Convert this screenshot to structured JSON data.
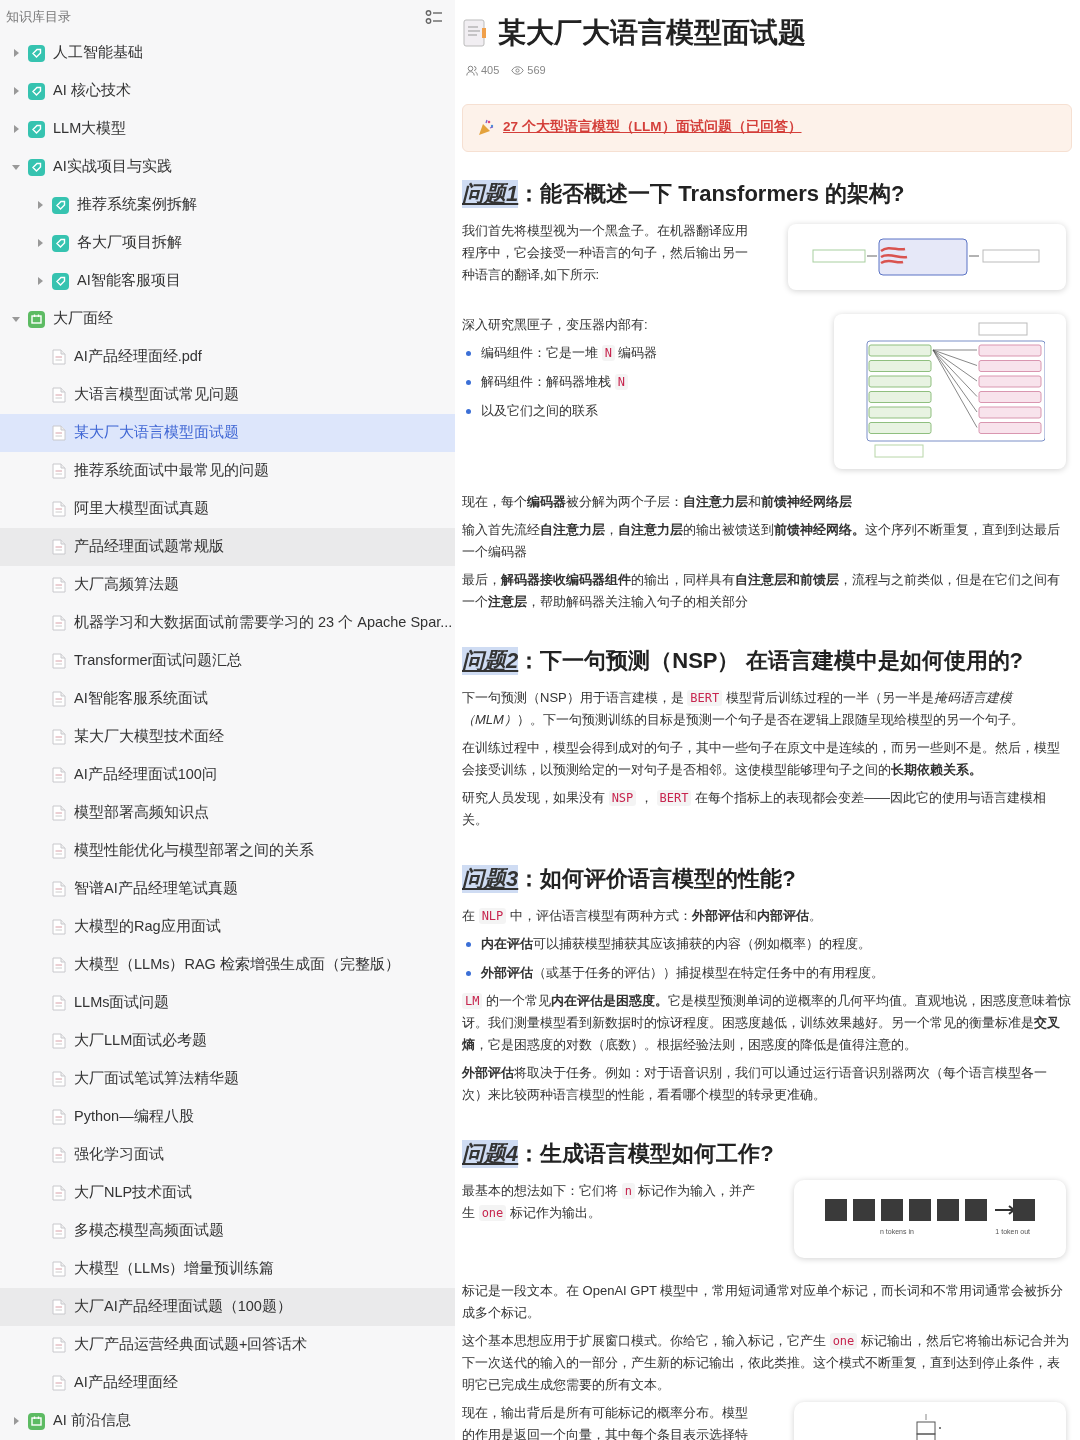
{
  "sidebar": {
    "title": "知识库目录",
    "items": [
      {
        "kind": "folder",
        "label": "人工智能基础",
        "expanded": false,
        "selected": false,
        "highlighted": false
      },
      {
        "kind": "folder",
        "label": "AI 核心技术",
        "expanded": false,
        "selected": false,
        "highlighted": false
      },
      {
        "kind": "folder",
        "label": "LLM大模型",
        "expanded": false,
        "selected": false,
        "highlighted": false
      },
      {
        "kind": "folder",
        "label": "AI实战项目与实践",
        "expanded": true,
        "selected": false,
        "highlighted": false,
        "children": [
          {
            "kind": "folder",
            "label": "推荐系统案例拆解",
            "expanded": false,
            "selected": false,
            "highlighted": false
          },
          {
            "kind": "folder",
            "label": "各大厂项目拆解",
            "expanded": false,
            "selected": false,
            "highlighted": false
          },
          {
            "kind": "folder",
            "label": "AI智能客服项目",
            "expanded": false,
            "selected": false,
            "highlighted": false
          }
        ]
      },
      {
        "kind": "board",
        "label": "大厂面经",
        "expanded": true,
        "selected": false,
        "highlighted": false,
        "children": [
          {
            "kind": "doc",
            "label": "AI产品经理面经.pdf",
            "selected": false,
            "highlighted": false
          },
          {
            "kind": "doc",
            "label": "大语言模型面试常见问题",
            "selected": false,
            "highlighted": false
          },
          {
            "kind": "doc",
            "label": "某大厂大语言模型面试题",
            "selected": true,
            "highlighted": false
          },
          {
            "kind": "doc",
            "label": "推荐系统面试中最常见的问题",
            "selected": false,
            "highlighted": false
          },
          {
            "kind": "doc",
            "label": "阿里大模型面试真题",
            "selected": false,
            "highlighted": false
          },
          {
            "kind": "doc",
            "label": "产品经理面试题常规版",
            "selected": false,
            "highlighted": true
          },
          {
            "kind": "doc",
            "label": "大厂高频算法题",
            "selected": false,
            "highlighted": false
          },
          {
            "kind": "doc",
            "label": "机器学习和大数据面试前需要学习的 23 个 Apache Spar...",
            "selected": false,
            "highlighted": false
          },
          {
            "kind": "doc",
            "label": "Transformer面试问题汇总",
            "selected": false,
            "highlighted": false
          },
          {
            "kind": "doc",
            "label": "AI智能客服系统面试",
            "selected": false,
            "highlighted": false
          },
          {
            "kind": "doc",
            "label": "某大厂大模型技术面经",
            "selected": false,
            "highlighted": false
          },
          {
            "kind": "doc",
            "label": "AI产品经理面试100问",
            "selected": false,
            "highlighted": false
          },
          {
            "kind": "doc",
            "label": "模型部署高频知识点",
            "selected": false,
            "highlighted": false
          },
          {
            "kind": "doc",
            "label": "模型性能优化与模型部署之间的关系",
            "selected": false,
            "highlighted": false
          },
          {
            "kind": "doc",
            "label": "智谱AI产品经理笔试真题",
            "selected": false,
            "highlighted": false
          },
          {
            "kind": "doc",
            "label": "大模型的Rag应用面试",
            "selected": false,
            "highlighted": false
          },
          {
            "kind": "doc",
            "label": "大模型（LLMs）RAG 检索增强生成面（完整版）",
            "selected": false,
            "highlighted": false
          },
          {
            "kind": "doc",
            "label": "LLMs面试问题",
            "selected": false,
            "highlighted": false
          },
          {
            "kind": "doc",
            "label": "大厂LLM面试必考题",
            "selected": false,
            "highlighted": false
          },
          {
            "kind": "doc",
            "label": "大厂面试笔试算法精华题",
            "selected": false,
            "highlighted": false
          },
          {
            "kind": "doc",
            "label": "Python—编程八股",
            "selected": false,
            "highlighted": false
          },
          {
            "kind": "doc",
            "label": "强化学习面试",
            "selected": false,
            "highlighted": false
          },
          {
            "kind": "doc",
            "label": "大厂NLP技术面试",
            "selected": false,
            "highlighted": false
          },
          {
            "kind": "doc",
            "label": "多模态模型高频面试题",
            "selected": false,
            "highlighted": false
          },
          {
            "kind": "doc",
            "label": "大模型（LLMs）增量预训练篇",
            "selected": false,
            "highlighted": false
          },
          {
            "kind": "doc",
            "label": "大厂AI产品经理面试题（100题）",
            "selected": false,
            "highlighted": true
          },
          {
            "kind": "doc",
            "label": "大厂产品运营经典面试题+回答话术",
            "selected": false,
            "highlighted": false
          },
          {
            "kind": "doc",
            "label": "AI产品经理面经",
            "selected": false,
            "highlighted": false
          }
        ]
      },
      {
        "kind": "board",
        "label": "AI 前沿信息",
        "expanded": false,
        "selected": false,
        "highlighted": false
      }
    ]
  },
  "article": {
    "title": "某大厂大语言模型面试题",
    "members": "405",
    "views": "569",
    "callout": "27 个大型语言模型（LLM）面试问题（已回答）",
    "sections": [
      {
        "label": "问题1",
        "heading": "：能否概述一下 Transformers 的架构?",
        "blocks": [
          {
            "kind": "split",
            "figure": {
              "kind": "overview"
            },
            "blocks": [
              {
                "kind": "para",
                "segments": [
                  {
                    "kind": "text",
                    "text": "我们首先将模型视为一个黑盒子。在机器翻译应用程序中，它会接受一种语言的句子，然后输出另一种语言的翻译,如下所示:"
                  }
                ]
              }
            ]
          },
          {
            "kind": "split",
            "figure": {
              "kind": "stack"
            },
            "blocks": [
              {
                "kind": "para",
                "segments": [
                  {
                    "kind": "text",
                    "text": "深入研究黑匣子，变压器内部有:"
                  }
                ]
              },
              {
                "kind": "bullets",
                "items": [
                  [
                    {
                      "kind": "text",
                      "text": "编码组件：它是一堆 "
                    },
                    {
                      "kind": "code",
                      "text": "N"
                    },
                    {
                      "kind": "text",
                      "text": " 编码器"
                    }
                  ],
                  [
                    {
                      "kind": "text",
                      "text": "解码组件：解码器堆栈 "
                    },
                    {
                      "kind": "code",
                      "text": "N"
                    }
                  ],
                  [
                    {
                      "kind": "text",
                      "text": "以及它们之间的联系"
                    }
                  ]
                ]
              }
            ]
          },
          {
            "kind": "para",
            "segments": [
              {
                "kind": "text",
                "text": "现在，每个**编码器**被分解为两个子层：**自注意力层**和**前馈神经网络层**"
              }
            ]
          },
          {
            "kind": "para",
            "segments": [
              {
                "kind": "text",
                "text": "输入首先流经**自注意力层**，**自注意力层**的输出被馈送到**前馈神经网络。**这个序列不断重复，直到到达最后一个编码器"
              }
            ]
          },
          {
            "kind": "para",
            "segments": [
              {
                "kind": "text",
                "text": "最后，**解码器接收编码器组件**的输出，同样具有**自注意层和前馈层**，流程与之前类似，但是在它们之间有一个**注意层**，帮助解码器关注输入句子的相关部分"
              }
            ]
          }
        ]
      },
      {
        "label": "问题2",
        "heading": "：下一句预测（NSP） 在语言建模中是如何使用的?",
        "blocks": [
          {
            "kind": "para",
            "segments": [
              {
                "kind": "text",
                "text": "下一句预测（NSP）用于语言建模，是 "
              },
              {
                "kind": "code",
                "text": "BERT"
              },
              {
                "kind": "text",
                "text": " 模型背后训练过程的一半（另一半是"
              },
              {
                "kind": "italic",
                "text": "掩码语言建模（MLM）"
              },
              {
                "kind": "text",
                "text": "）。下一句预测训练的目标是预测一个句子是否在逻辑上跟随呈现给模型的另一个句子。"
              }
            ]
          },
          {
            "kind": "para",
            "segments": [
              {
                "kind": "text",
                "text": "在训练过程中，模型会得到成对的句子，其中一些句子在原文中是连续的，而另一些则不是。然后，模型会接受训练，以预测给定的一对句子是否相邻。这使模型能够理句子之间的**长期依赖关系。**"
              }
            ]
          },
          {
            "kind": "para",
            "segments": [
              {
                "kind": "text",
                "text": "研究人员发现，如果没有 "
              },
              {
                "kind": "code",
                "text": "NSP"
              },
              {
                "kind": "text",
                "text": " ， "
              },
              {
                "kind": "code",
                "text": "BERT"
              },
              {
                "kind": "text",
                "text": " 在每个指标上的表现都会变差——因此它的使用与语言建模相关。"
              }
            ]
          }
        ]
      },
      {
        "label": "问题3",
        "heading": "：如何评价语言模型的性能?",
        "blocks": [
          {
            "kind": "para",
            "segments": [
              {
                "kind": "text",
                "text": "在 "
              },
              {
                "kind": "code",
                "text": "NLP"
              },
              {
                "kind": "text",
                "text": " 中，评估语言模型有两种方式：**外部评估**和**内部评估**。"
              }
            ]
          },
          {
            "kind": "bullets",
            "items": [
              [
                {
                  "kind": "text",
                  "text": "**内在评估**可以捕获模型捕获其应该捕获的内容（例如概率）的程度。"
                }
              ],
              [
                {
                  "kind": "text",
                  "text": "**外部评估**（或基于任务的评估））捕捉模型在特定任务中的有用程度。"
                }
              ]
            ]
          },
          {
            "kind": "para",
            "segments": [
              {
                "kind": "code",
                "text": "LM"
              },
              {
                "kind": "text",
                "text": " 的一个常见**内在评估是困惑度。**它是模型预测单词的逆概率的几何平均值。直观地说，困惑度意味着惊讶。我们测量模型看到新数据时的惊讶程度。困惑度越低，训练效果越好。另一个常见的衡量标准是**交叉熵**，它是困惑度的对数（底数）。根据经验法则，困惑度的降低是值得注意的。"
              }
            ]
          },
          {
            "kind": "para",
            "segments": [
              {
                "kind": "text",
                "text": "**外部评估**将取决于任务。例如：对于语音识别，我们可以通过运行语音识别器两次（每个语言模型各一次）来比较两种语言模型的性能，看看哪个模型的转录更准确。"
              }
            ]
          }
        ]
      },
      {
        "label": "问题4",
        "heading": "：生成语言模型如何工作?",
        "blocks": [
          {
            "kind": "split",
            "figure": {
              "kind": "tokens",
              "captions": [
                "n tokens in",
                "1 token out"
              ]
            },
            "blocks": [
              {
                "kind": "para",
                "segments": [
                  {
                    "kind": "text",
                    "text": "最基本的想法如下：它们将 "
                  },
                  {
                    "kind": "code",
                    "text": "n"
                  },
                  {
                    "kind": "text",
                    "text": " 标记作为输入，并产生 "
                  },
                  {
                    "kind": "code",
                    "text": "one"
                  },
                  {
                    "kind": "text",
                    "text": " 标记作为输出。"
                  }
                ]
              }
            ]
          },
          {
            "kind": "para",
            "segments": [
              {
                "kind": "text",
                "text": "标记是一段文本。在 OpenAI GPT 模型中，常用短词通常对应单个标记，而长词和不常用词通常会被拆分成多个标记。"
              }
            ]
          },
          {
            "kind": "para",
            "segments": [
              {
                "kind": "text",
                "text": "这个基本思想应用于扩展窗口模式。你给它，输入标记，它产生 "
              },
              {
                "kind": "code",
                "text": "one"
              },
              {
                "kind": "text",
                "text": " 标记输出，然后它将输出标记合并为下一次送代的输入的一部分，产生新的标记输出，依此类推。这个模式不断重复，直到达到停止条件，表明它已完成生成您需要的所有文本。"
              }
            ]
          },
          {
            "kind": "split",
            "figure": {
              "kind": "probability"
            },
            "blocks": [
              {
                "kind": "para",
                "segments": [
                  {
                    "kind": "text",
                    "text": "现在，输出背后是所有可能标记的概率分布。模型的作用是返回一个向量，其中每个条目表示选择特"
                  }
                ]
              }
            ]
          }
        ]
      }
    ]
  }
}
